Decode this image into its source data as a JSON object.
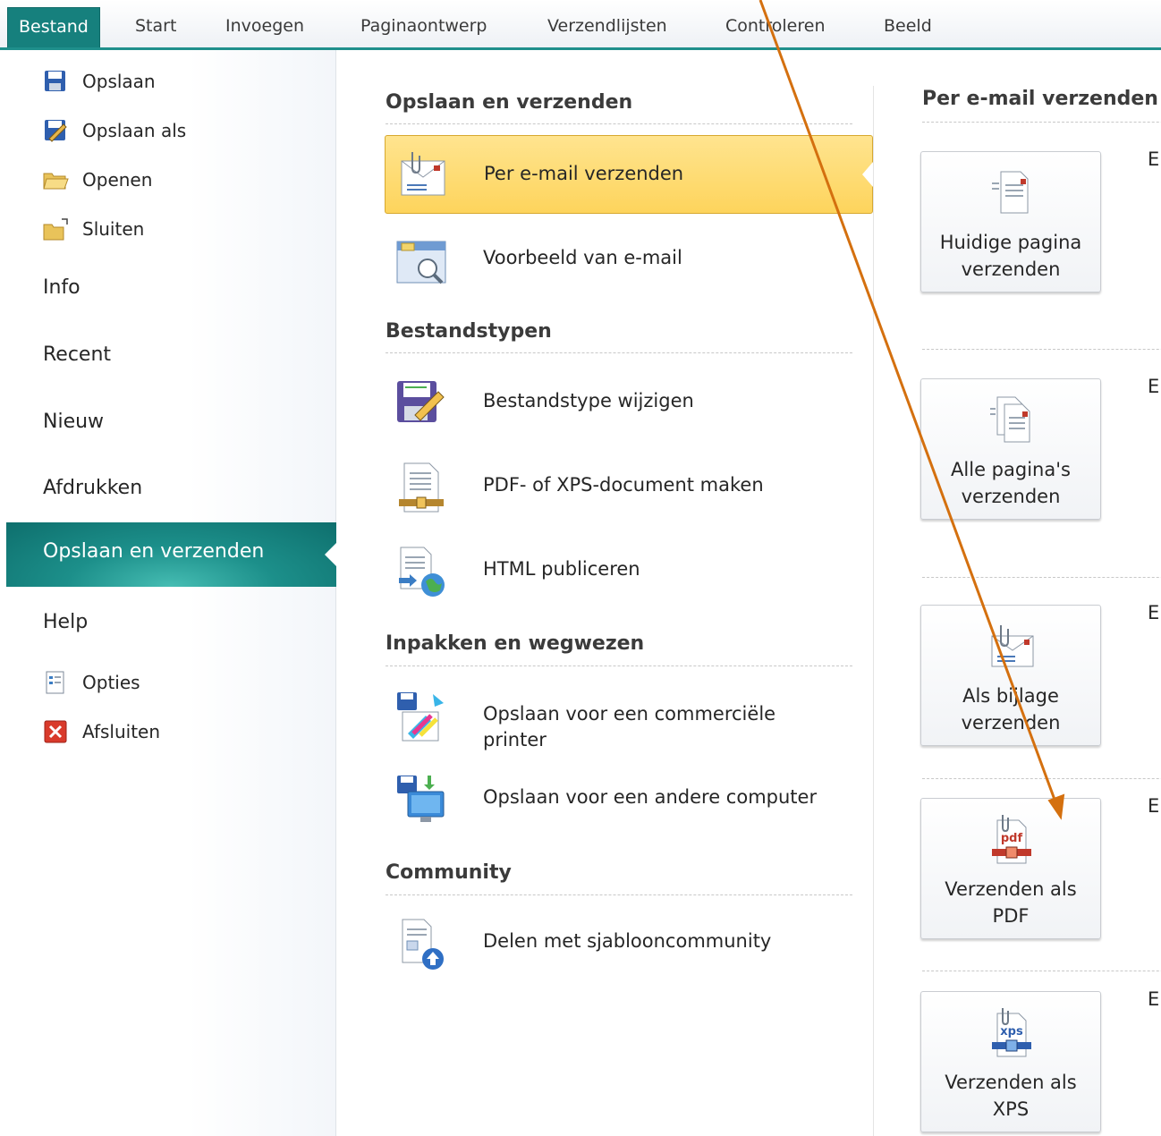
{
  "ribbon": {
    "tabs": [
      "Bestand",
      "Start",
      "Invoegen",
      "Paginaontwerp",
      "Verzendlijsten",
      "Controleren",
      "Beeld"
    ]
  },
  "left": {
    "opslaan": "Opslaan",
    "opslaan_als": "Opslaan als",
    "openen": "Openen",
    "sluiten": "Sluiten",
    "info": "Info",
    "recent": "Recent",
    "nieuw": "Nieuw",
    "afdrukken": "Afdrukken",
    "opslaan_verzenden": "Opslaan en verzenden",
    "help": "Help",
    "opties": "Opties",
    "afsluiten": "Afsluiten"
  },
  "middle": {
    "sections": [
      "Opslaan en verzenden",
      "Bestandstypen",
      "Inpakken en wegwezen",
      "Community"
    ],
    "items": {
      "email": "Per e-mail verzenden",
      "preview": "Voorbeeld van e-mail",
      "filetype": "Bestandstype wijzigen",
      "pdfxps": "PDF- of XPS-document maken",
      "html": "HTML publiceren",
      "commercial_1": "Opslaan voor een commerciële",
      "commercial_2": "printer",
      "other_computer": "Opslaan voor een andere computer",
      "share": "Delen met sjablooncommunity"
    }
  },
  "right": {
    "title": "Per e-mail verzenden",
    "buttons": [
      {
        "line1": "Huidige pagina",
        "line2": "verzenden",
        "icon": "page-send-icon"
      },
      {
        "line1": "Alle pagina's",
        "line2": "verzenden",
        "icon": "pages-send-icon"
      },
      {
        "line1": "Als bijlage",
        "line2": "verzenden",
        "icon": "attachment-icon"
      },
      {
        "line1": "Verzenden als",
        "line2": "PDF",
        "icon": "pdf-icon"
      },
      {
        "line1": "Verzenden als",
        "line2": "XPS",
        "icon": "xps-icon"
      }
    ],
    "truncated_char": "E"
  },
  "colors": {
    "accent": "#16807d",
    "selected_item": "#fdd45c",
    "arrow": "#d4700f"
  }
}
